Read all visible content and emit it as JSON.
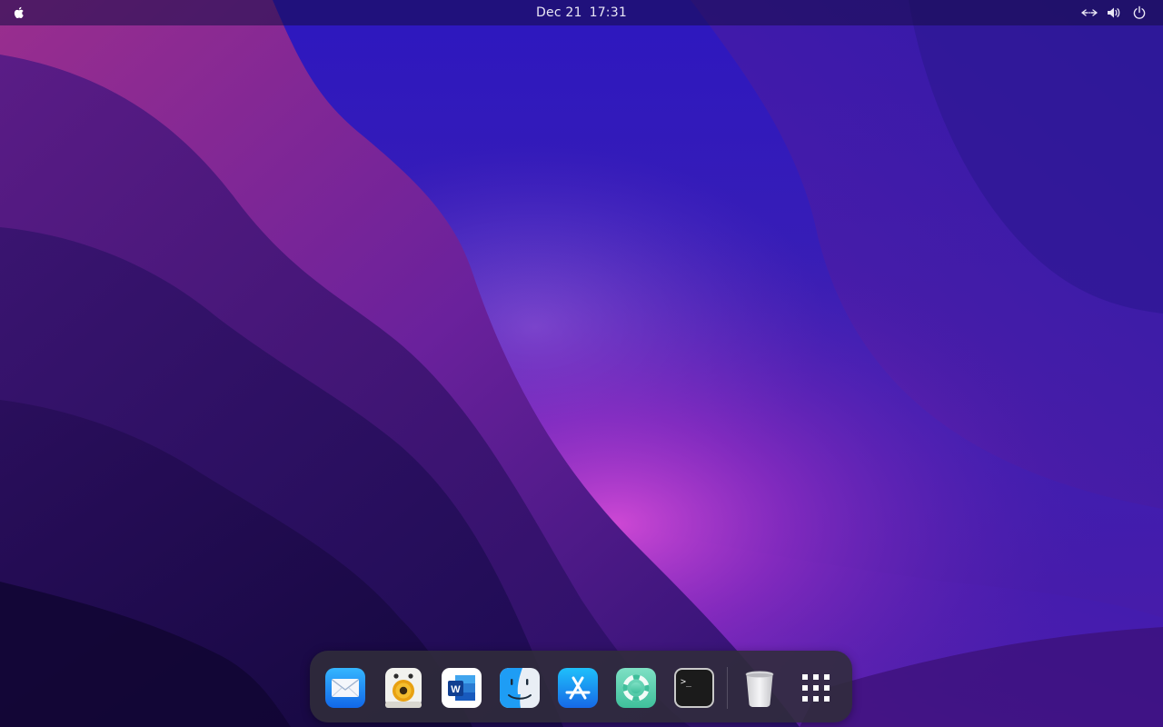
{
  "topbar": {
    "apple_menu_icon": "apple-logo-icon",
    "clock": {
      "date": "Dec 21",
      "time": "17:31"
    },
    "tray": [
      {
        "name": "network",
        "icon": "network-wired-icon"
      },
      {
        "name": "volume",
        "icon": "volume-icon"
      },
      {
        "name": "power",
        "icon": "power-icon"
      }
    ]
  },
  "dock": {
    "items": [
      {
        "name": "mail",
        "icon": "mail-icon"
      },
      {
        "name": "rhythmbox",
        "icon": "rhythmbox-icon"
      },
      {
        "name": "word",
        "icon": "microsoft-word-icon",
        "label": "W"
      },
      {
        "name": "finder",
        "icon": "finder-icon"
      },
      {
        "name": "app-store",
        "icon": "app-store-icon"
      },
      {
        "name": "help",
        "icon": "help-lifebuoy-icon"
      },
      {
        "name": "terminal",
        "icon": "terminal-icon",
        "label": ">_"
      },
      {
        "name": "trash",
        "icon": "trash-icon"
      },
      {
        "name": "show-applications",
        "icon": "app-grid-icon"
      }
    ]
  },
  "colors": {
    "wallpaper_top": "#2b16b8",
    "wallpaper_mid": "#5a1fa8",
    "wallpaper_glow": "#c03ad0",
    "wallpaper_dark": "#1a0c4a",
    "dock_background": "#302c3a",
    "topbar_text": "#e8e6f4"
  }
}
